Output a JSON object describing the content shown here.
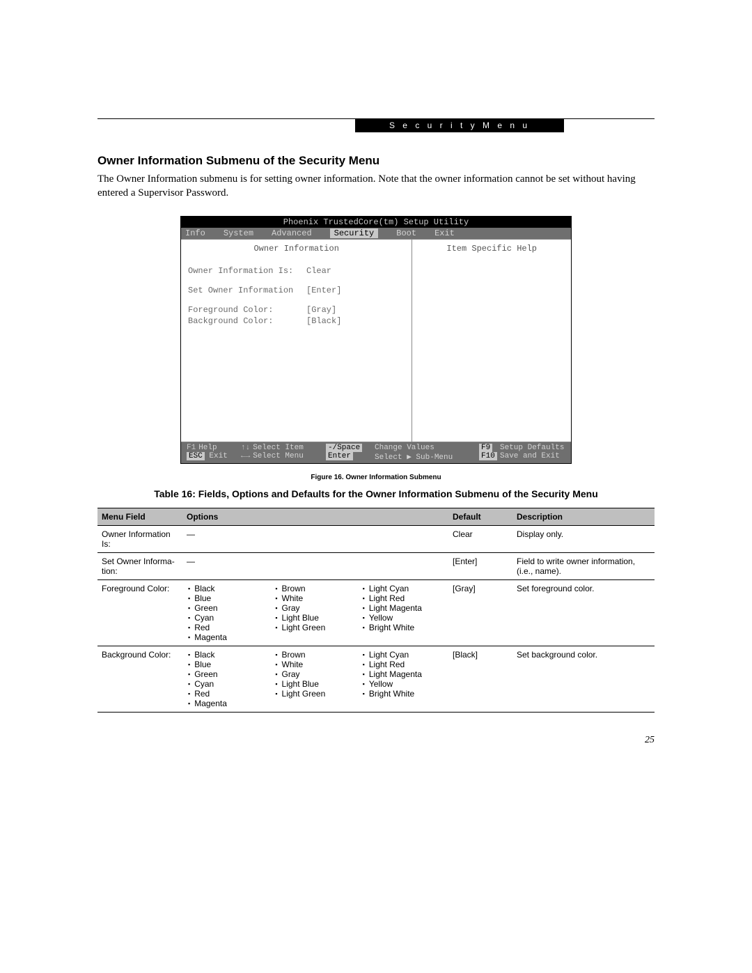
{
  "header_tag": "S e c u r i t y   M e n u",
  "heading": "Owner Information Submenu of the Security Menu",
  "intro": "The Owner Information submenu is for setting owner information. Note that the owner information cannot be set without having entered a Supervisor Password.",
  "bios": {
    "title": "Phoenix TrustedCore(tm) Setup Utility",
    "menus": [
      "Info",
      "System",
      "Advanced",
      "Security",
      "Boot",
      "Exit"
    ],
    "active_menu": "Security",
    "left_title": "Owner Information",
    "right_title": "Item Specific Help",
    "rows": [
      {
        "label": "Owner Information Is:",
        "value": "Clear"
      },
      {
        "label": "Set Owner Information",
        "value": "[Enter]"
      },
      {
        "label": "Foreground Color:",
        "value": "[Gray]"
      },
      {
        "label": "Background Color:",
        "value": "[Black]"
      }
    ],
    "footer": {
      "r1": {
        "k1": "F1",
        "t1": "Help",
        "k2": "↑↓",
        "t2": "Select Item",
        "k3": "-/Space",
        "t3": "Change Values",
        "k4": "F9",
        "t4": "Setup Defaults"
      },
      "r2": {
        "k1": "ESC",
        "t1": "Exit",
        "k2": "←→",
        "t2": "Select Menu",
        "k3": "Enter",
        "t3": "Select ▶ Sub-Menu",
        "k4": "F10",
        "t4": "Save and Exit"
      }
    }
  },
  "figure_caption": "Figure 16.  Owner Information Submenu",
  "table_title": "Table 16: Fields, Options and Defaults for the Owner Information Submenu of the Security Menu",
  "table": {
    "headers": {
      "menu": "Menu Field",
      "options": "Options",
      "default": "Default",
      "desc": "Description"
    },
    "rows": [
      {
        "menu": "Owner Information Is:",
        "options_dash": "—",
        "default": "Clear",
        "desc": "Display only."
      },
      {
        "menu": "Set Owner Informa­tion:",
        "options_dash": "—",
        "default": "[Enter]",
        "desc": "Field to write owner informa­tion, (i.e., name)."
      },
      {
        "menu": "Foreground Color:",
        "options": {
          "col1": [
            "Black",
            "Blue",
            "Green",
            "Cyan",
            "Red",
            "Magenta"
          ],
          "col2": [
            "Brown",
            "White",
            "Gray",
            "Light Blue",
            "Light Green"
          ],
          "col3": [
            "Light Cyan",
            "Light Red",
            "Light Magenta",
            "Yellow",
            "Bright White"
          ]
        },
        "default": "[Gray]",
        "desc": "Set foreground color."
      },
      {
        "menu": "Background Color:",
        "options": {
          "col1": [
            "Black",
            "Blue",
            "Green",
            "Cyan",
            "Red",
            "Magenta"
          ],
          "col2": [
            "Brown",
            "White",
            "Gray",
            "Light Blue",
            "Light Green"
          ],
          "col3": [
            "Light Cyan",
            "Light Red",
            "Light Magenta",
            "Yellow",
            "Bright White"
          ]
        },
        "default": "[Black]",
        "desc": "Set background color."
      }
    ]
  },
  "page_number": "25"
}
